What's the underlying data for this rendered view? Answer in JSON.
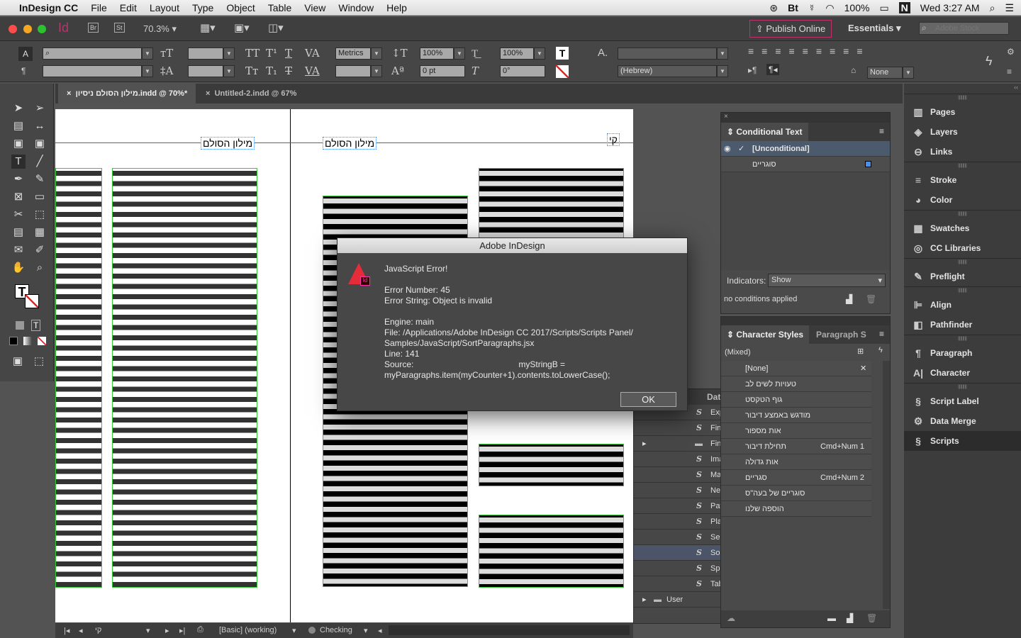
{
  "menubar": {
    "app": "InDesign CC",
    "items": [
      "File",
      "Edit",
      "Layout",
      "Type",
      "Object",
      "Table",
      "View",
      "Window",
      "Help"
    ],
    "battery": "100%",
    "clock": "Wed 3:27 AM"
  },
  "appbar": {
    "logo": "Id",
    "bridge": "Br",
    "stock": "St",
    "zoom": "70.3%",
    "publish": "Publish Online",
    "workspace": "Essentials",
    "search_placeholder": "Adobe Stock"
  },
  "control": {
    "kerning": "Metrics",
    "vscale": "100%",
    "hscale": "100%",
    "baseline": "0 pt",
    "skew": "0°",
    "language": "(Hebrew)",
    "justification": "None"
  },
  "tabs": [
    {
      "label": "מילון הסולם ניסיון.indd @ 70%*"
    },
    {
      "label": "Untitled-2.indd @ 67%"
    }
  ],
  "document": {
    "running_head_left": "מילון הסולם",
    "running_head_right": "מילון הסולם",
    "page_letter": "קי"
  },
  "conditional_text": {
    "title": "Conditional Text",
    "rows": [
      {
        "label": "[Unconditional]",
        "color": "none"
      },
      {
        "label": "סוגריים",
        "color": "#4a90e8"
      }
    ],
    "indicators_label": "Indicators:",
    "indicators_value": "Show",
    "status": "no conditions applied"
  },
  "character_styles": {
    "title": "Character Styles",
    "other_tab": "Paragraph S",
    "current": "(Mixed)",
    "rows": [
      {
        "name": "[None]",
        "shortcut": ""
      },
      {
        "name": "טעויות לשים לב",
        "shortcut": ""
      },
      {
        "name": "גוף הטקסט",
        "shortcut": ""
      },
      {
        "name": "מודגש באמצע דיבור",
        "shortcut": ""
      },
      {
        "name": "אות מספור",
        "shortcut": ""
      },
      {
        "name": "תחילת דיבור",
        "shortcut": "Cmd+Num 1"
      },
      {
        "name": "אות גדולה",
        "shortcut": ""
      },
      {
        "name": "סגריים",
        "shortcut": "Cmd+Num 2"
      },
      {
        "name": "סוגריים של בעה\"ס",
        "shortcut": ""
      },
      {
        "name": "הוספה שלנו",
        "shortcut": ""
      }
    ]
  },
  "scripts": {
    "header": "Dat",
    "rows": [
      {
        "label": "Exp",
        "folder": false
      },
      {
        "label": "Fin",
        "folder": false
      },
      {
        "label": "Fin",
        "folder": true
      },
      {
        "label": "Ima",
        "folder": false
      },
      {
        "label": "Mal",
        "folder": false
      },
      {
        "label": "Nee",
        "folder": false
      },
      {
        "label": "Pat",
        "folder": false
      },
      {
        "label": "Plac",
        "folder": false
      },
      {
        "label": "Sele",
        "folder": false
      },
      {
        "label": "Sor",
        "folder": false,
        "selected": true
      },
      {
        "label": "Spl",
        "folder": false
      },
      {
        "label": "Tab",
        "folder": false
      }
    ],
    "user_folder": "User"
  },
  "dock": [
    [
      "Pages",
      "Layers",
      "Links"
    ],
    [
      "Stroke",
      "Color"
    ],
    [
      "Swatches",
      "CC Libraries"
    ],
    [
      "Preflight"
    ],
    [
      "Align",
      "Pathfinder"
    ],
    [
      "Paragraph",
      "Character"
    ],
    [
      "Script Label",
      "Data Merge",
      "Scripts"
    ]
  ],
  "dialog": {
    "title": "Adobe InDesign",
    "heading": "JavaScript Error!",
    "error_number": "Error Number: 45",
    "error_string": "Error String: Object is invalid",
    "engine": "Engine: main",
    "file1": "File: /Applications/Adobe InDesign CC 2017/Scripts/Scripts Panel/",
    "file2": "Samples/JavaScript/SortParagraphs.jsx",
    "line": "Line: 141",
    "source_label": "Source:",
    "source1": "myStringB =",
    "source2": "myParagraphs.item(myCounter+1).contents.toLowerCase();",
    "ok": "OK"
  },
  "status": {
    "page": "קי",
    "preflight_profile": "[Basic] (working)",
    "preflight_status": "Checking"
  }
}
